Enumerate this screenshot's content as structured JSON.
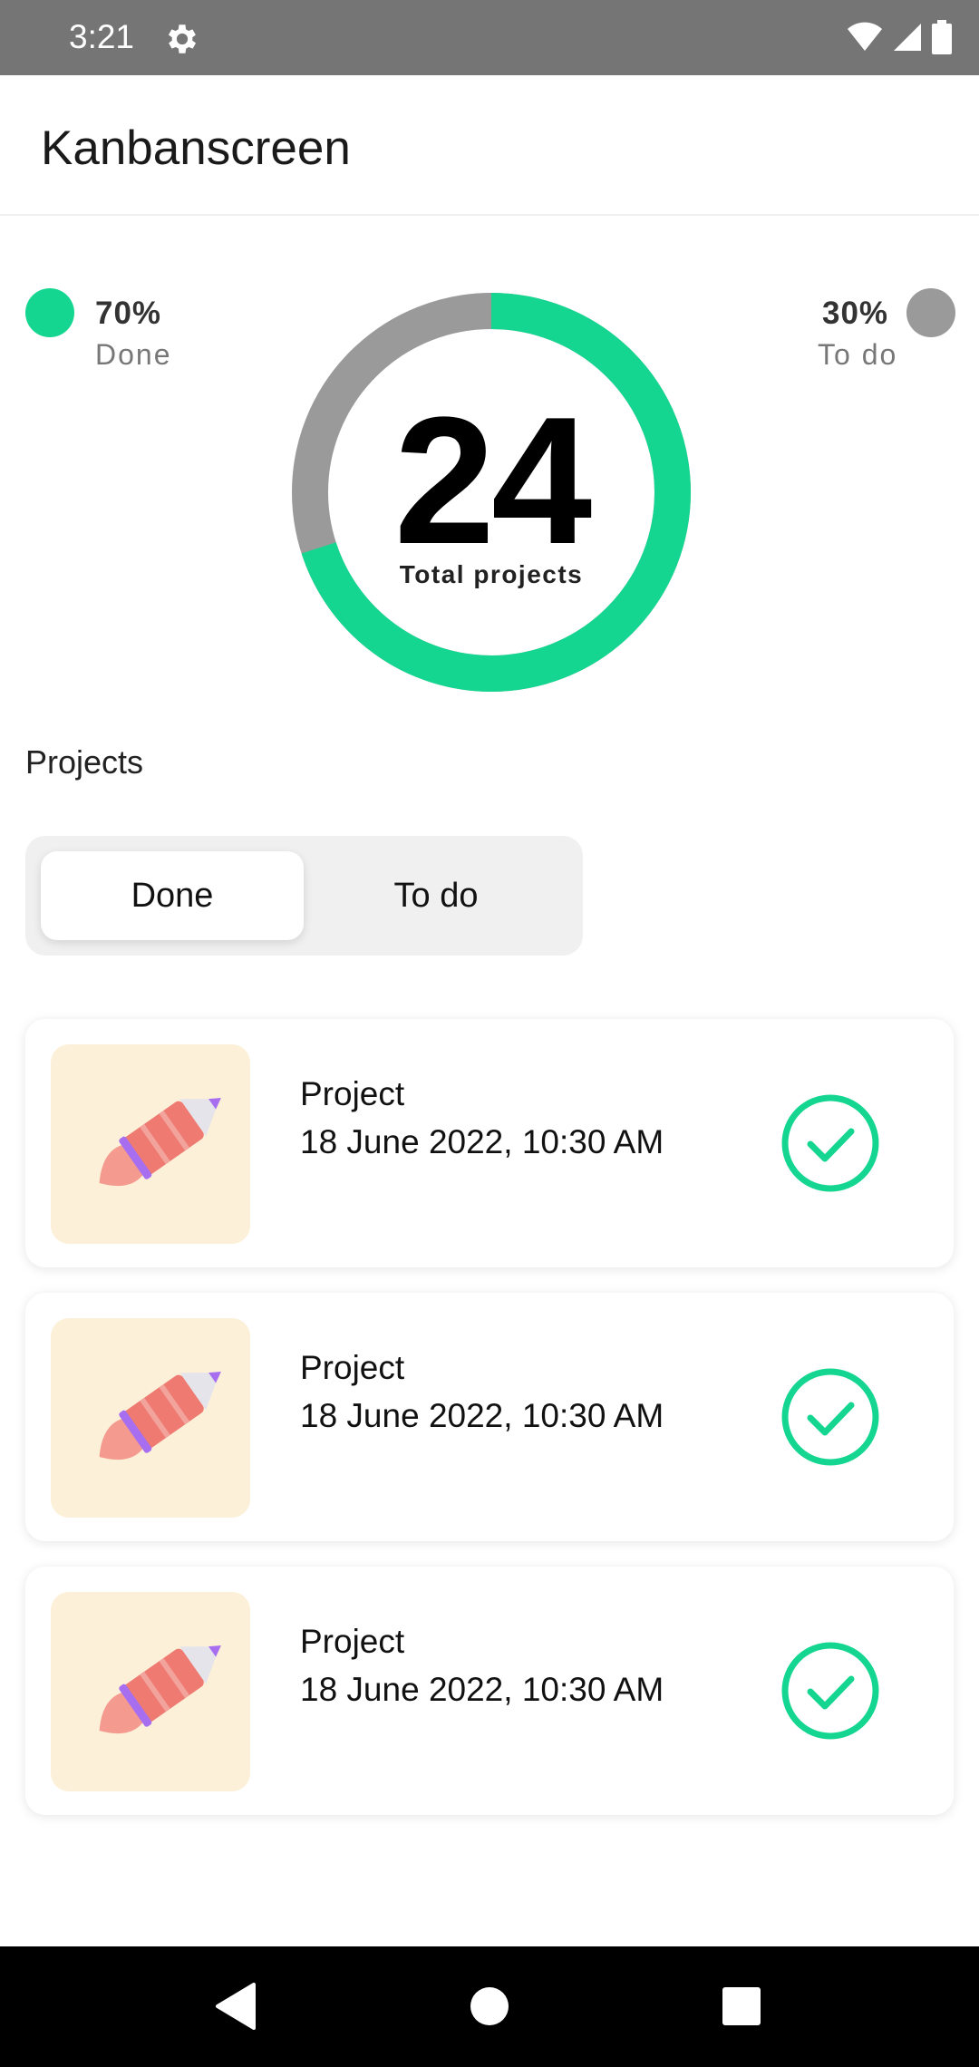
{
  "status_bar": {
    "time": "3:21"
  },
  "app_bar": {
    "title": "Kanbanscreen"
  },
  "summary": {
    "done_percent": "70%",
    "done_label": "Done",
    "todo_percent": "30%",
    "todo_label": "To do",
    "total": "24",
    "total_label": "Total projects",
    "done_fraction": 0.7
  },
  "colors": {
    "done": "#14d690",
    "todo": "#9a9a9a",
    "accent": "#14d690"
  },
  "projects": {
    "section_title": "Projects",
    "filters": [
      {
        "label": "Done",
        "selected": true
      },
      {
        "label": "To do",
        "selected": false
      }
    ],
    "items": [
      {
        "name": "Project",
        "date": "18 June 2022, 10:30 AM",
        "status_icon": "check-circle-icon",
        "thumb_icon": "rocket-icon"
      },
      {
        "name": "Project",
        "date": "18 June 2022, 10:30 AM",
        "status_icon": "check-circle-icon",
        "thumb_icon": "rocket-icon"
      },
      {
        "name": "Project",
        "date": "18 June 2022, 10:30 AM",
        "status_icon": "check-circle-icon",
        "thumb_icon": "rocket-icon"
      }
    ]
  },
  "nav_bar": {
    "buttons": [
      "back-icon",
      "home-icon",
      "recents-icon"
    ]
  }
}
